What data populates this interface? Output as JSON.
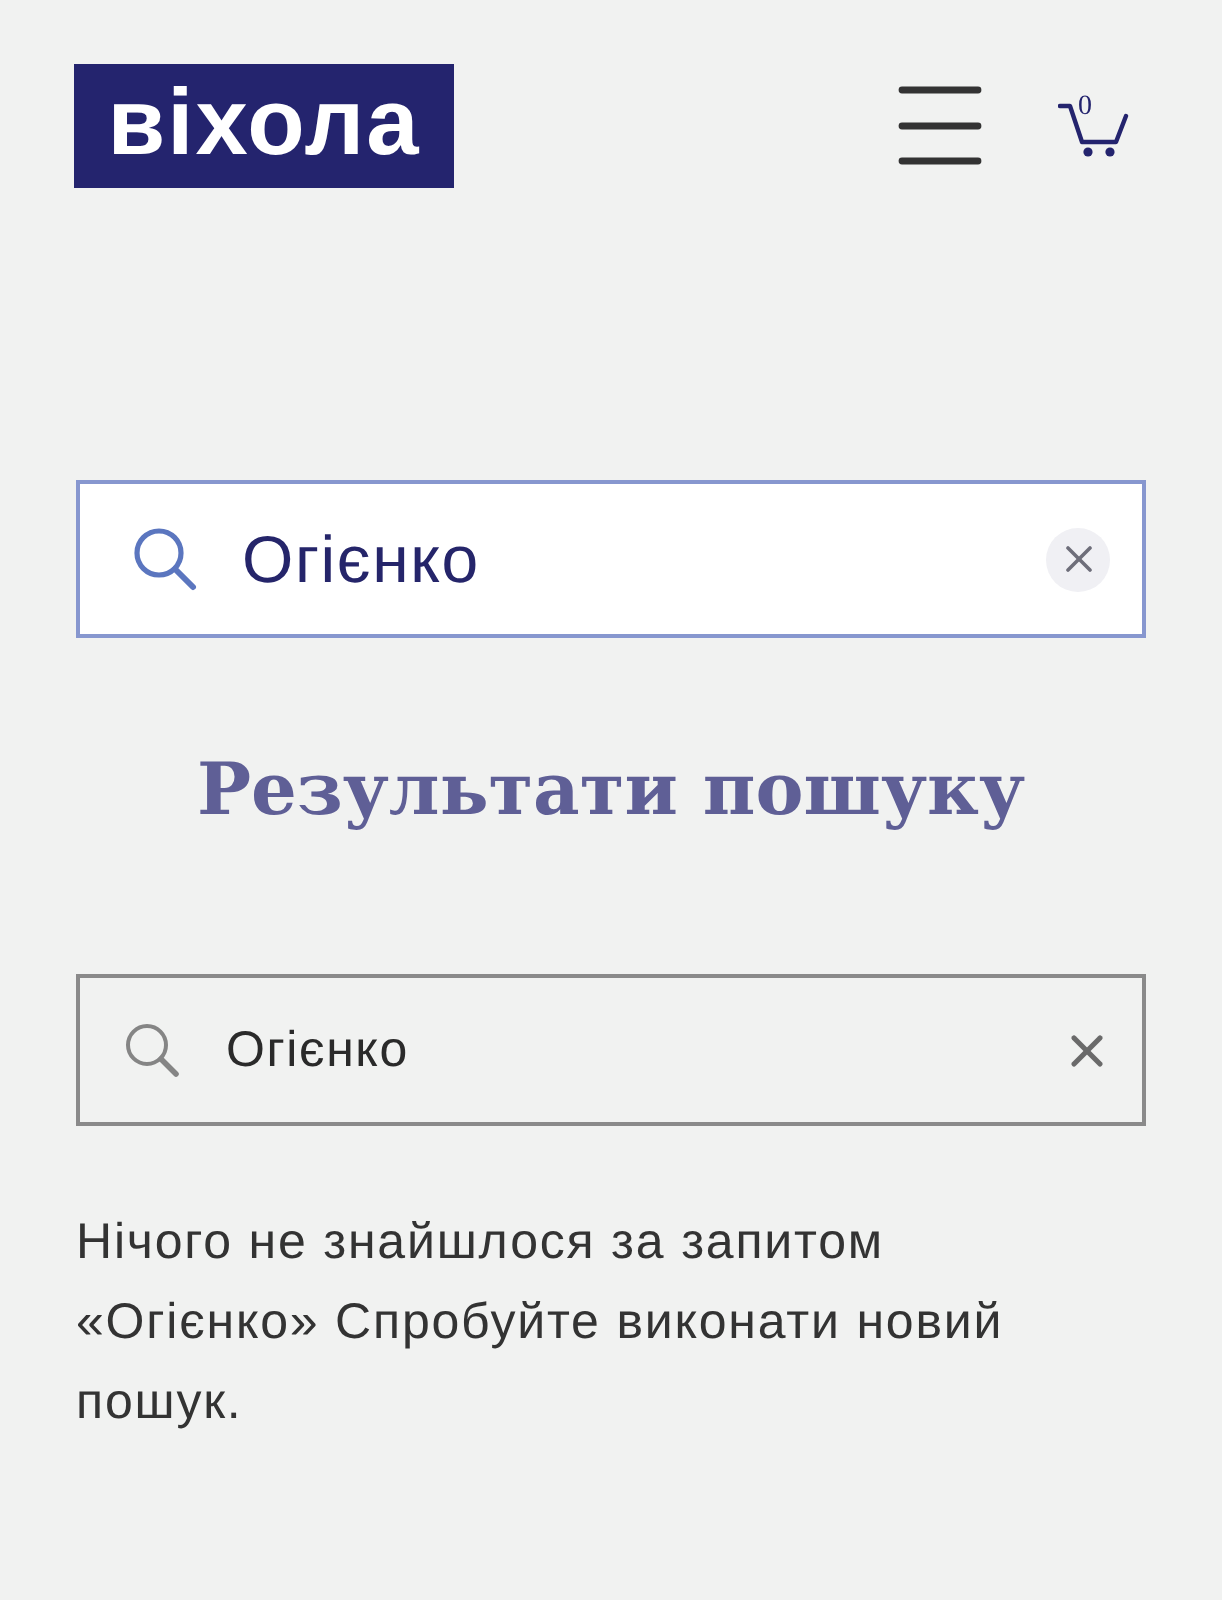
{
  "header": {
    "logo": "віхола",
    "cart": {
      "count": "0"
    }
  },
  "search_bar": {
    "value": "Огієнко"
  },
  "results": {
    "title": "Результати пошуку",
    "search": {
      "value": "Огієнко"
    },
    "message": "Нічого не знайшлося за запитом «Огієнко» Спробуйте виконати новий пошук."
  }
}
